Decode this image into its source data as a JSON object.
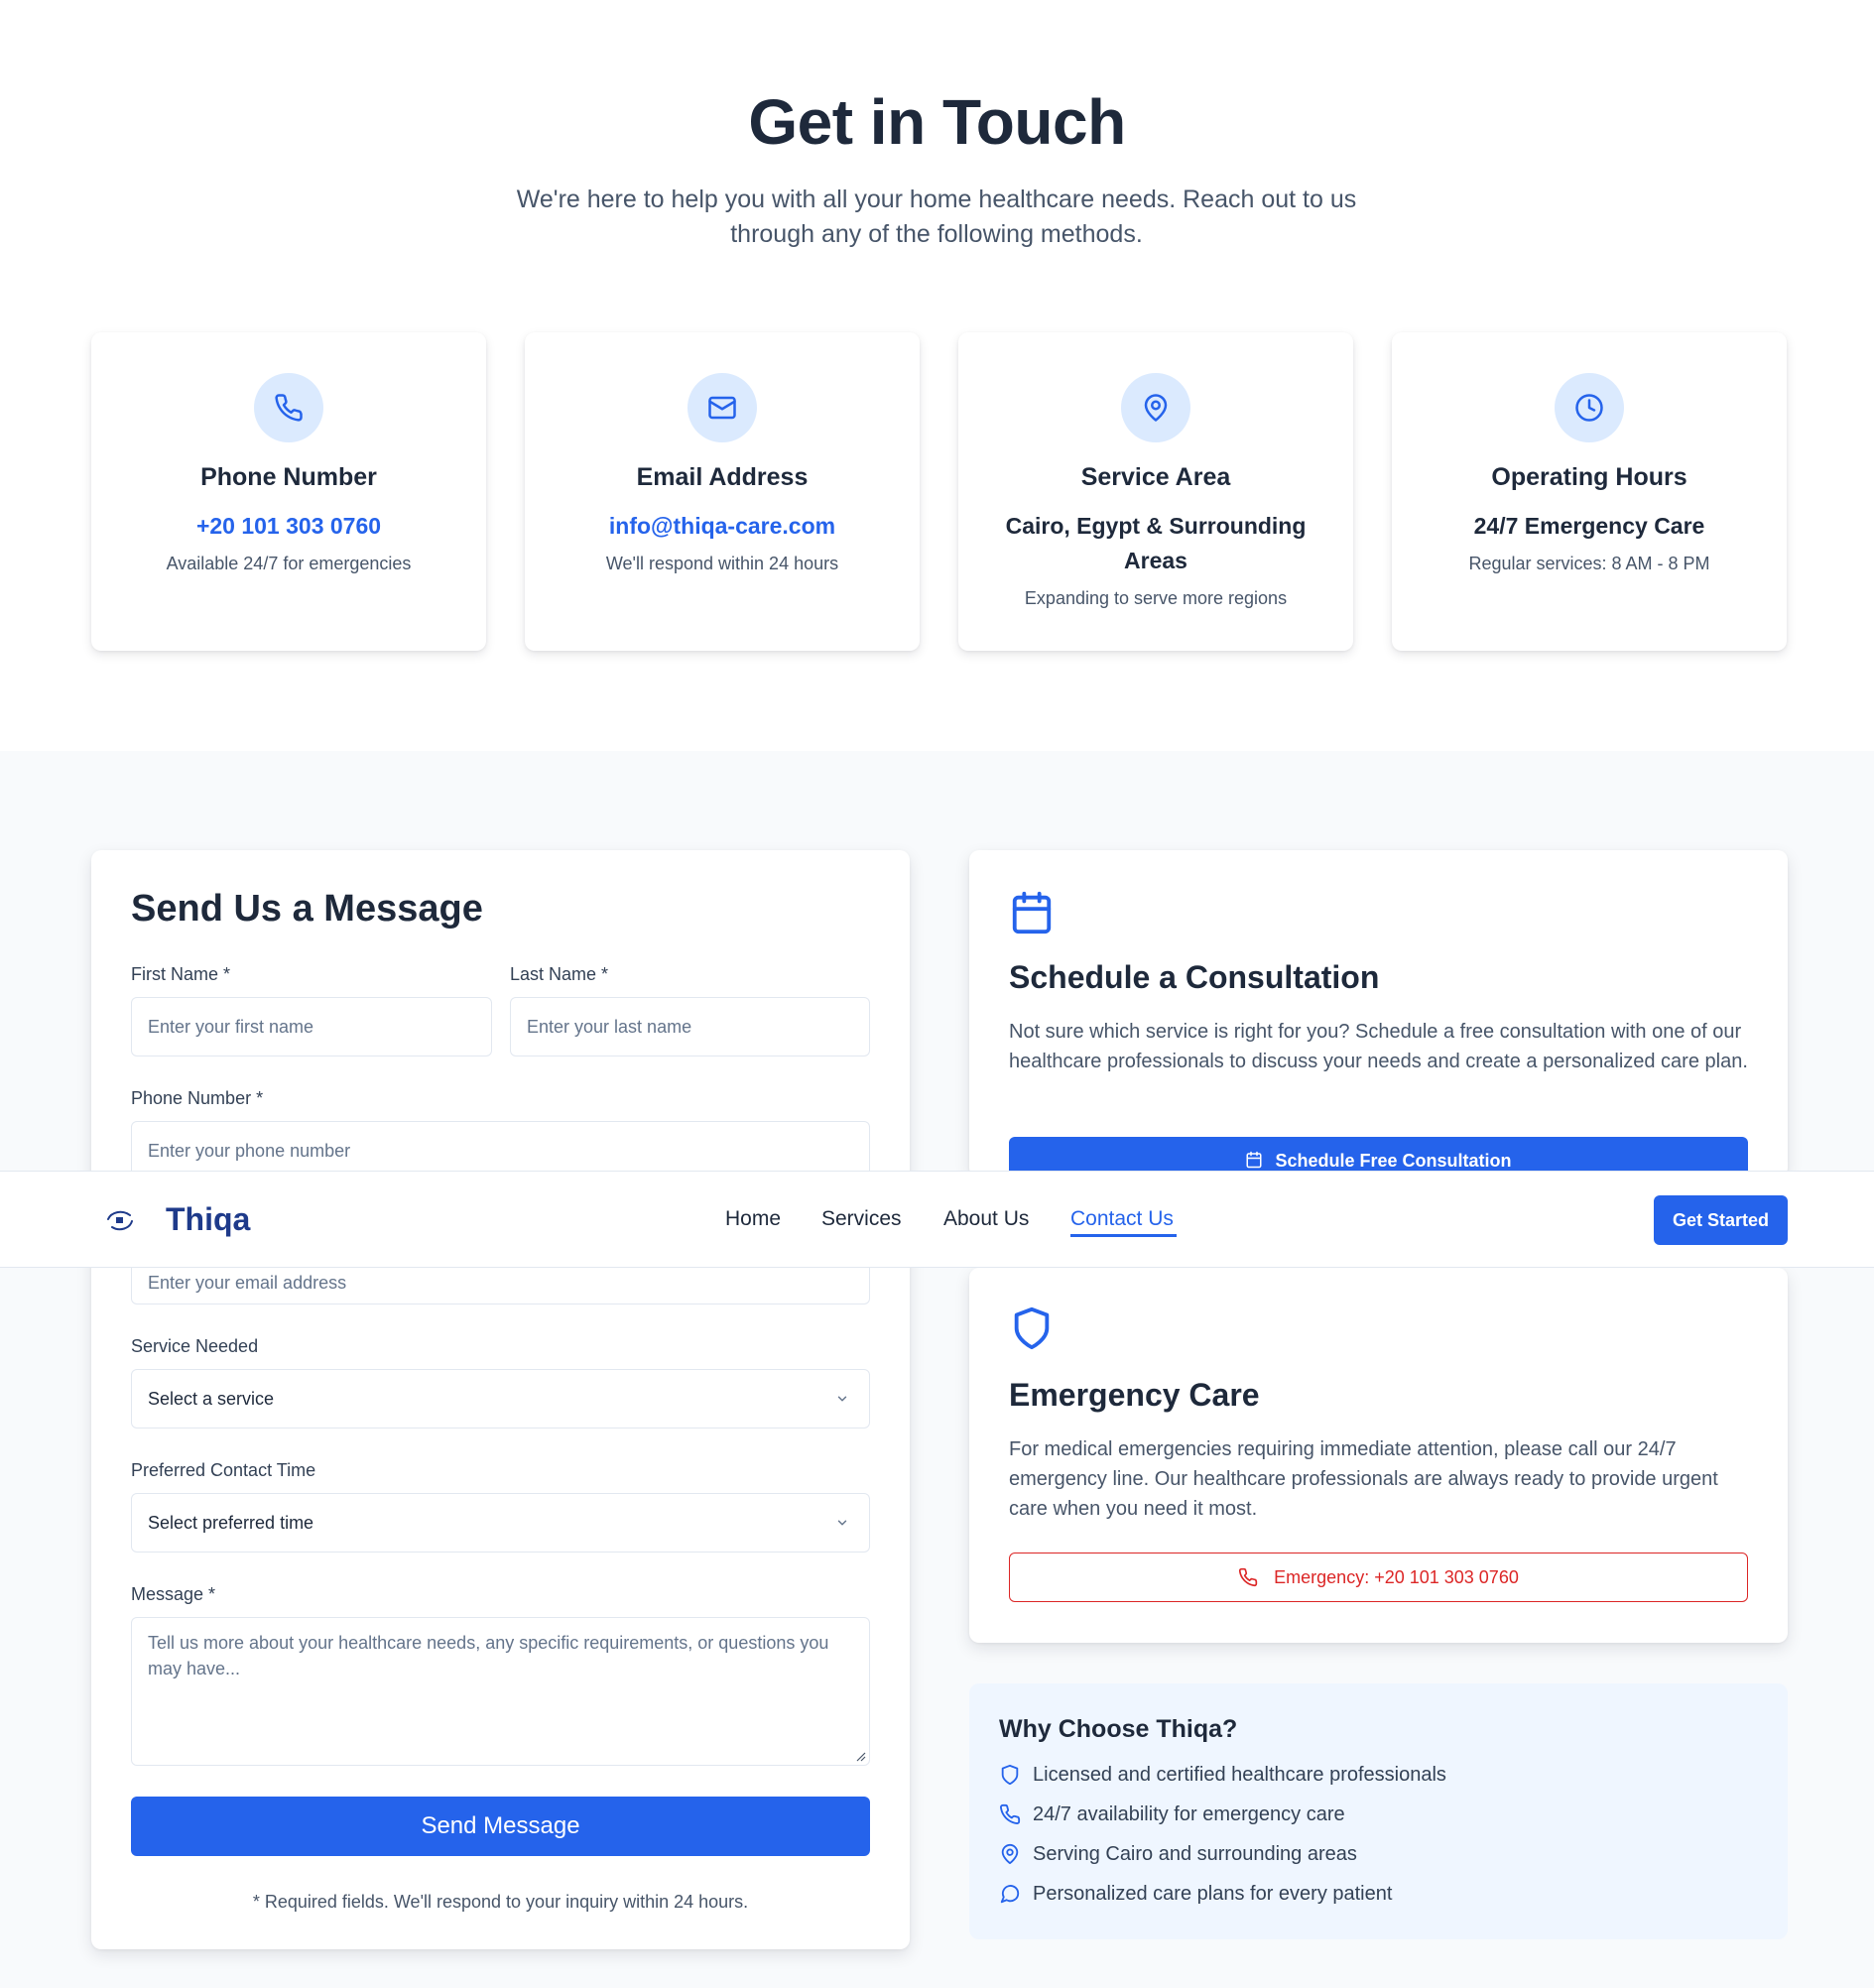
{
  "hero": {
    "title": "Get in Touch",
    "subtitle": "We're here to help you with all your home healthcare needs. Reach out to us through any of the following methods."
  },
  "contact_cards": [
    {
      "icon": "phone-icon",
      "title": "Phone Number",
      "value": "+20 101 303 0760",
      "note": "Available 24/7 for emergencies"
    },
    {
      "icon": "mail-icon",
      "title": "Email Address",
      "value": "info@thiqa-care.com",
      "note": "We'll respond within 24 hours"
    },
    {
      "icon": "map-pin-icon",
      "title": "Service Area",
      "value": "Cairo, Egypt & Surrounding Areas",
      "note": "Expanding to serve more regions"
    },
    {
      "icon": "clock-icon",
      "title": "Operating Hours",
      "value": "24/7 Emergency Care",
      "note": "Regular services: 8 AM - 8 PM"
    }
  ],
  "form": {
    "title": "Send Us a Message",
    "first_name": {
      "label": "First Name *",
      "placeholder": "Enter your first name"
    },
    "last_name": {
      "label": "Last Name *",
      "placeholder": "Enter your last name"
    },
    "phone": {
      "label": "Phone Number *",
      "placeholder": "Enter your phone number"
    },
    "email": {
      "placeholder": "Enter your email address"
    },
    "service": {
      "label": "Service Needed",
      "value": "Select a service"
    },
    "contact_time": {
      "label": "Preferred Contact Time",
      "value": "Select preferred time"
    },
    "message": {
      "label": "Message *",
      "placeholder": "Tell us more about your healthcare needs, any specific requirements, or questions you may have..."
    },
    "submit_label": "Send Message",
    "note": "* Required fields. We'll respond to your inquiry within 24 hours."
  },
  "consultation": {
    "icon": "calendar-icon",
    "title": "Schedule a Consultation",
    "text": "Not sure which service is right for you? Schedule a free consultation with one of our healthcare professionals to discuss your needs and create a personalized care plan.",
    "button_label": "Schedule Free Consultation"
  },
  "emergency": {
    "icon": "shield-icon",
    "title": "Emergency Care",
    "text": "For medical emergencies requiring immediate attention, please call our 24/7 emergency line. Our healthcare professionals are always ready to provide urgent care when you need it most.",
    "button_label": "Emergency: +20 101 303 0760"
  },
  "why": {
    "title": "Why Choose Thiqa?",
    "items": [
      {
        "icon": "shield-icon",
        "text": "Licensed and certified healthcare professionals"
      },
      {
        "icon": "phone-icon",
        "text": "24/7 availability for emergency care"
      },
      {
        "icon": "map-pin-icon",
        "text": "Serving Cairo and surrounding areas"
      },
      {
        "icon": "message-icon",
        "text": "Personalized care plans for every patient"
      }
    ]
  },
  "nav": {
    "brand": "Thiqa",
    "links": [
      "Home",
      "Services",
      "About Us",
      "Contact Us"
    ],
    "active": "Contact Us",
    "cta_label": "Get Started"
  },
  "colors": {
    "primary": "#2563eb",
    "brand_dark": "#1e3a8a",
    "emergency": "#dc2626",
    "icon_bg": "#dbeafe",
    "section_bg": "#f8fafc",
    "why_bg": "#eff6ff"
  }
}
